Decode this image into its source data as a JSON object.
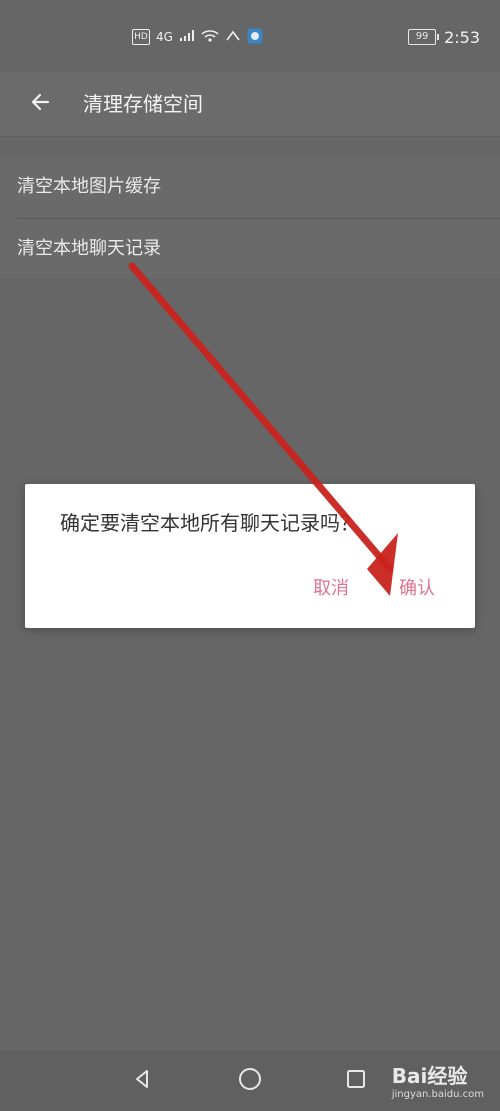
{
  "status_bar": {
    "hd_label": "HD",
    "network_label": "4G",
    "battery_level": "99",
    "time": "2:53"
  },
  "header": {
    "title": "清理存储空间",
    "back_icon": "back-arrow-icon"
  },
  "settings": {
    "items": [
      {
        "label": "清空本地图片缓存"
      },
      {
        "label": "清空本地聊天记录"
      }
    ]
  },
  "dialog": {
    "message": "确定要清空本地所有聊天记录吗？",
    "cancel_label": "取消",
    "confirm_label": "确认",
    "accent_color": "#e0738f"
  },
  "watermark": {
    "brand": "Bai经验",
    "url": "jingyan.baidu.com"
  }
}
